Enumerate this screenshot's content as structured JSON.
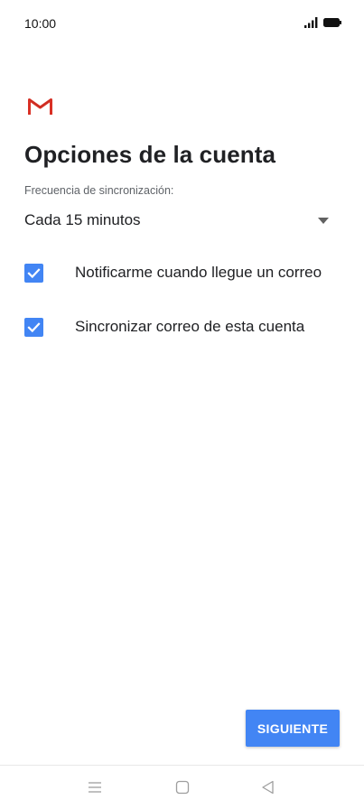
{
  "status_bar": {
    "time": "10:00",
    "signal_icon": "cellular-signal-icon",
    "battery_icon": "battery-full-icon"
  },
  "header": {
    "app_icon": "gmail-icon",
    "title": "Opciones de la cuenta"
  },
  "sync": {
    "label": "Frecuencia de sincronización:",
    "value": "Cada 15 minutos",
    "dropdown_icon": "dropdown-arrow-icon"
  },
  "options": [
    {
      "label": "Notificarme cuando llegue un correo",
      "checked": true
    },
    {
      "label": "Sincronizar correo de esta cuenta",
      "checked": true
    }
  ],
  "actions": {
    "next_label": "SIGUIENTE"
  },
  "nav_bar": {
    "menu_icon": "menu-icon",
    "home_icon": "home-icon",
    "back_icon": "back-icon"
  },
  "colors": {
    "accent": "#4285f4",
    "gmail_red": "#d93025",
    "text_primary": "#202124",
    "text_secondary": "#5f6368"
  }
}
